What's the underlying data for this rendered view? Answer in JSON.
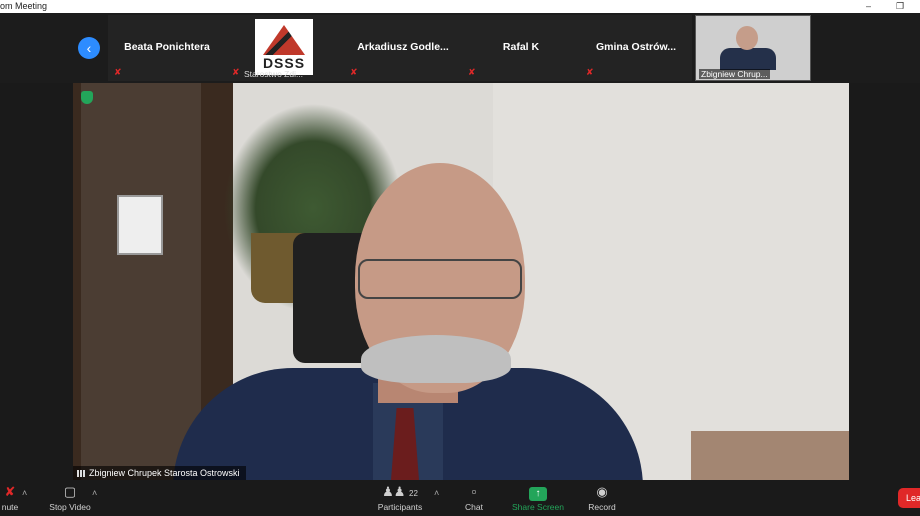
{
  "window": {
    "title": "om Meeting",
    "minimize_icon": "minimize-icon",
    "maximize_icon": "maximize-icon"
  },
  "strip": {
    "nav_icon": "chevron-left-icon",
    "tiles": [
      {
        "name": "Beata Ponichtera",
        "muted": true
      },
      {
        "name": "Starostwo Zdi...",
        "muted": true,
        "logo_text": "DSSS"
      },
      {
        "name": "Arkadiusz  Godle...",
        "muted": true
      },
      {
        "name": "Rafal K",
        "muted": true
      },
      {
        "name": "Gmina  Ostrów...",
        "muted": true
      }
    ],
    "self_view_name": "Zbigniew Chrup..."
  },
  "main_video": {
    "speaker_label": "Zbigniew Chrupek Starosta Ostrowski",
    "security_icon": "shield-icon"
  },
  "toolbar": {
    "mute_label": "nute",
    "stop_video_label": "Stop Video",
    "participants_label": "Participants",
    "participants_count": "22",
    "chat_label": "Chat",
    "share_screen_label": "Share Screen",
    "record_label": "Record",
    "leave_label": "Lea"
  },
  "colors": {
    "accent_blue": "#2d8cff",
    "share_green": "#23a55a",
    "leave_red": "#e02828",
    "mute_red": "#e02828",
    "toolbar_bg": "#1a1a1a"
  }
}
